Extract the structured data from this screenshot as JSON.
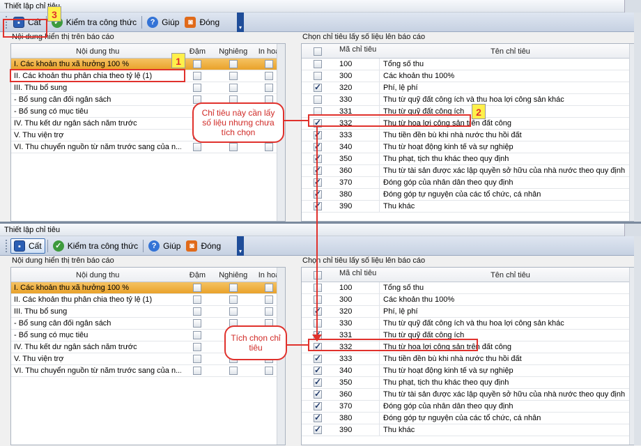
{
  "window": {
    "title": "Thiết lập chỉ tiêu"
  },
  "toolbar": {
    "save_label": "Cất",
    "check_label": "Kiểm tra công thức",
    "help_label": "Giúp",
    "close_label": "Đóng"
  },
  "left": {
    "section_title": "Nội dung hiển thị trên báo cáo",
    "columns": [
      "Nội dung thu",
      "Đậm",
      "Nghiêng",
      "In hoa"
    ],
    "rows": [
      "I. Các khoản thu xã hưởng 100 %",
      "II. Các khoản thu phân chia theo tỷ lệ (1)",
      "III. Thu bổ sung",
      "- Bổ sung cân đối ngân sách",
      "- Bổ sung có mục tiêu",
      "IV. Thu kết dư ngân sách năm trước",
      "V. Thu viện trợ",
      "VI. Thu chuyển nguồn từ năm trước sang của n..."
    ]
  },
  "right": {
    "section_title": "Chọn chỉ tiêu lấy số liệu lên báo cáo",
    "columns": [
      "Mã chỉ tiêu",
      "Tên chỉ tiêu"
    ],
    "rows": [
      {
        "code": "100",
        "name": "Tổng số thu"
      },
      {
        "code": "300",
        "name": "Các khoản thu 100%"
      },
      {
        "code": "320",
        "name": "Phí, lệ phí"
      },
      {
        "code": "330",
        "name": "Thu từ quỹ đất công ích và thu hoa lợi công sản khác"
      },
      {
        "code": "331",
        "name": "Thu từ quỹ đất công ích"
      },
      {
        "code": "332",
        "name": "Thu từ hoa lợi công sản trên đất công"
      },
      {
        "code": "333",
        "name": "Thu tiền đền bù khi nhà nước thu hồi đất"
      },
      {
        "code": "340",
        "name": "Thu từ hoạt động kinh tế và sự nghiệp"
      },
      {
        "code": "350",
        "name": "Thu phạt, tịch thu khác theo quy định"
      },
      {
        "code": "360",
        "name": "Thu từ tài sản được xác lập quyền sở hữu của nhà nước theo quy định"
      },
      {
        "code": "370",
        "name": "Đóng góp của nhân dân theo quy định"
      },
      {
        "code": "380",
        "name": "Đóng góp tự nguyện của các tổ chức, cá nhân"
      },
      {
        "code": "390",
        "name": "Thu khác"
      }
    ],
    "checked_before": [
      false,
      false,
      true,
      false,
      false,
      true,
      true,
      true,
      true,
      true,
      true,
      true,
      true
    ],
    "checked_after": [
      false,
      false,
      true,
      false,
      true,
      true,
      true,
      true,
      true,
      true,
      true,
      true,
      true
    ]
  },
  "annotations": {
    "n1": "1",
    "n2": "2",
    "n3": "3",
    "bubble1": "Chỉ tiêu này cần lấy số liệu nhưng chưa tích chọn",
    "bubble2": "Tích chọn chỉ tiêu"
  },
  "colors": {
    "highlight": "#e0312c",
    "selected_row": "#f0b44a",
    "toolbar": "#c6d1e2"
  }
}
